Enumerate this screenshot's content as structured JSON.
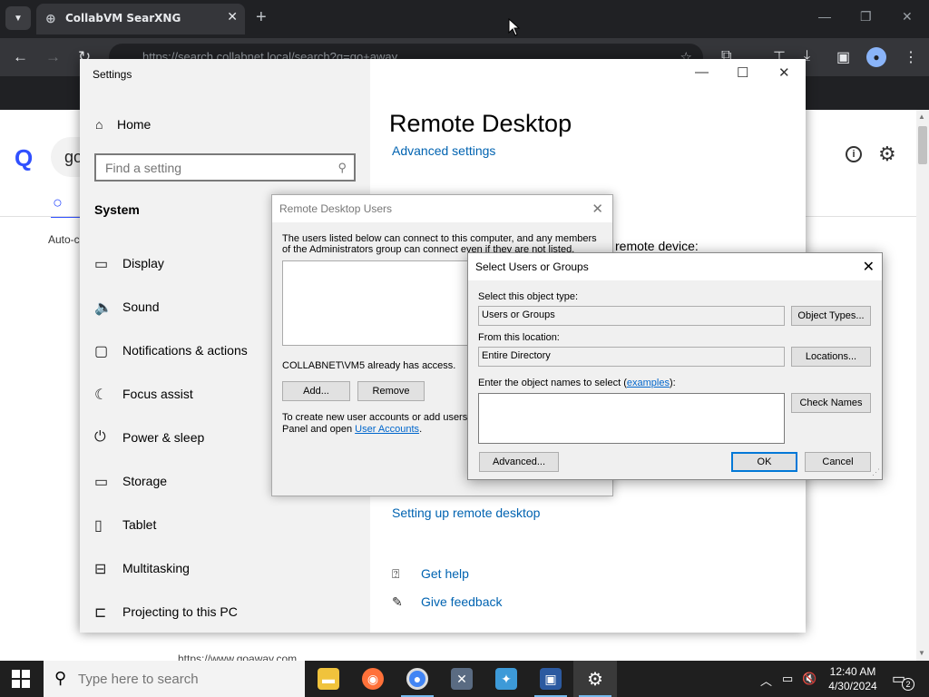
{
  "browser": {
    "tab_title": "CollabVM SearXNG",
    "url": "https://search.collabnet.local/search?q=go+away",
    "close_tab": "✕",
    "new_tab": "+"
  },
  "webpage": {
    "query_fragment": "go",
    "autocomplete": "Auto-c",
    "footer_url": "https://www.goaway.com"
  },
  "settings": {
    "window_title": "Settings",
    "home": "Home",
    "search_placeholder": "Find a setting",
    "section": "System",
    "nav": [
      {
        "label": "Display",
        "icon": "monitor-icon"
      },
      {
        "label": "Sound",
        "icon": "speaker-icon"
      },
      {
        "label": "Notifications & actions",
        "icon": "notification-icon"
      },
      {
        "label": "Focus assist",
        "icon": "moon-icon"
      },
      {
        "label": "Power & sleep",
        "icon": "power-icon"
      },
      {
        "label": "Storage",
        "icon": "storage-icon"
      },
      {
        "label": "Tablet",
        "icon": "tablet-icon"
      },
      {
        "label": "Multitasking",
        "icon": "multitasking-icon"
      },
      {
        "label": "Projecting to this PC",
        "icon": "projector-icon"
      }
    ],
    "page_title": "Remote Desktop",
    "advanced_settings": "Advanced settings",
    "remote_device_text": "remote device:",
    "setting_up_link": "Setting up remote desktop",
    "get_help": "Get help",
    "give_feedback": "Give feedback"
  },
  "rdu_dialog": {
    "title": "Remote Desktop Users",
    "description": "The users listed below can connect to this computer, and any members of the Administrators group can connect even if they are not listed.",
    "access_text": "COLLABNET\\VM5 already has access.",
    "add_button": "Add...",
    "remove_button": "Remove",
    "create_text_prefix": "To create new user accounts or add users t",
    "create_text_middle": "Panel and open ",
    "user_accounts_link": "User Accounts",
    "create_text_suffix": "."
  },
  "sug_dialog": {
    "title": "Select Users or Groups",
    "object_type_label": "Select this object type:",
    "object_type_value": "Users or Groups",
    "object_types_button": "Object Types...",
    "location_label": "From this location:",
    "location_value": "Entire Directory",
    "locations_button": "Locations...",
    "names_label_prefix": "Enter the object names to select (",
    "examples_link": "examples",
    "names_label_suffix": "):",
    "names_value": "",
    "check_names_button": "Check Names",
    "advanced_button": "Advanced...",
    "ok_button": "OK",
    "cancel_button": "Cancel"
  },
  "taskbar": {
    "search_placeholder": "Type here to search",
    "time": "12:40 AM",
    "date": "4/30/2024",
    "notification_count": "2"
  },
  "colors": {
    "link": "#0063b1",
    "searxng_blue": "#3050ff",
    "taskbar": "#1f1f1f",
    "chrome_dark": "#202124"
  }
}
